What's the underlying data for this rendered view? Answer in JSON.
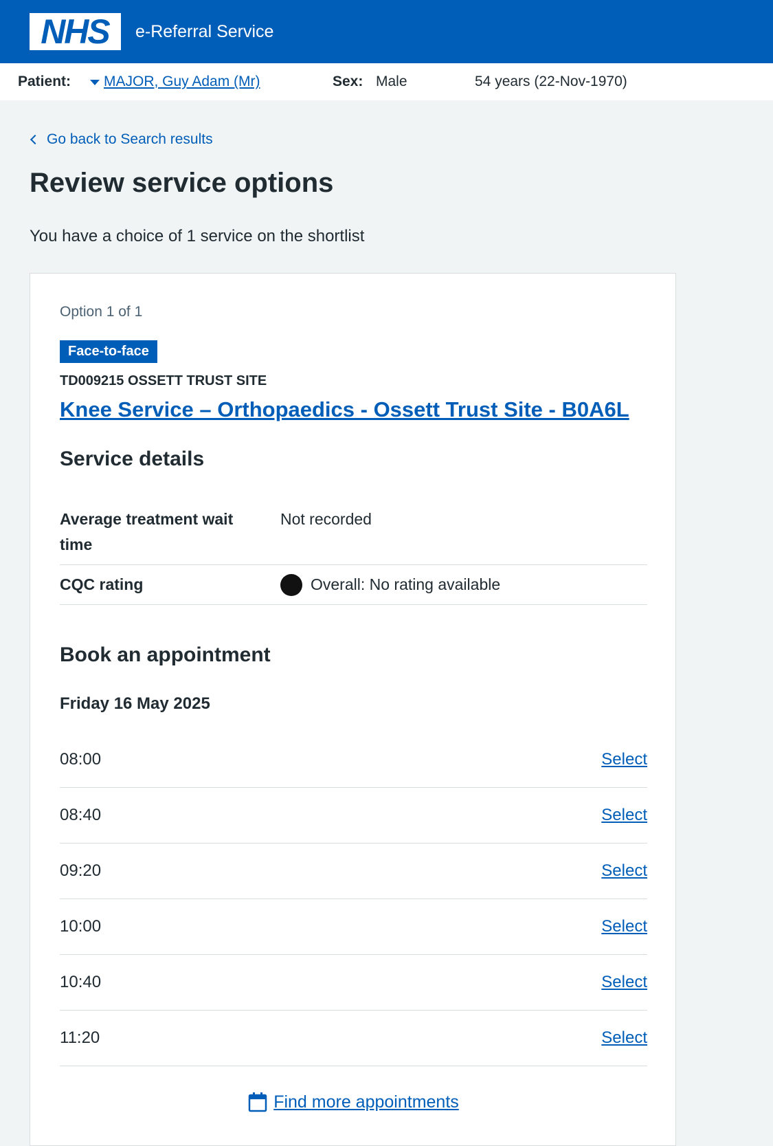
{
  "header": {
    "logo_text": "NHS",
    "service_name": "e-Referral Service"
  },
  "patient_bar": {
    "patient_label": "Patient:",
    "patient_name": "MAJOR, Guy Adam (Mr)",
    "sex_label": "Sex:",
    "sex_value": "Male",
    "age_dob": "54 years (22-Nov-1970)"
  },
  "nav": {
    "back_label": "Go back to Search results"
  },
  "page": {
    "title": "Review service options",
    "lede": "You have a choice of 1 service on the shortlist"
  },
  "option": {
    "count_label": "Option 1 of 1",
    "tag": "Face-to-face",
    "org_code": "TD009215 OSSETT TRUST SITE",
    "service_name": "Knee Service – Orthopaedics - Ossett Trust Site - B0A6L",
    "details_title": "Service details",
    "details": [
      {
        "key": "Average treatment wait time",
        "value": "Not recorded"
      },
      {
        "key": "CQC rating",
        "value": "Overall: No rating available"
      }
    ],
    "book_title": "Book an appointment",
    "date": "Friday 16 May 2025",
    "slots": [
      {
        "time": "08:00",
        "action": "Select"
      },
      {
        "time": "08:40",
        "action": "Select"
      },
      {
        "time": "09:20",
        "action": "Select"
      },
      {
        "time": "10:00",
        "action": "Select"
      },
      {
        "time": "10:40",
        "action": "Select"
      },
      {
        "time": "11:20",
        "action": "Select"
      }
    ],
    "more_label": "Find more appointments"
  },
  "colors": {
    "nhs_blue": "#005eb8",
    "page_bg": "#f0f4f5",
    "text": "#212b32",
    "secondary_text": "#4c6272",
    "border": "#d8dde0"
  }
}
